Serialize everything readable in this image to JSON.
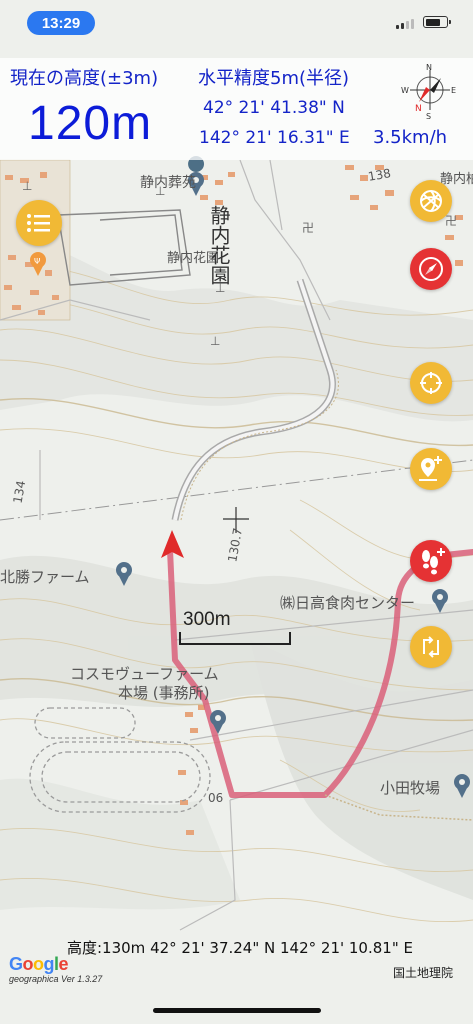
{
  "status_bar": {
    "time": "13:29"
  },
  "hud": {
    "altitude_label": "現在の高度(±3m)",
    "altitude_value": "120m",
    "accuracy_label": "水平精度5m(半径)",
    "latitude": "42° 21' 41.38\" N",
    "longitude": "142° 21' 16.31\" E",
    "speed": "3.5km/h"
  },
  "compass": {
    "north": "N",
    "south": "S",
    "east": "E",
    "west": "W"
  },
  "map_labels": {
    "cemetery": "静内葬苑",
    "park": "静内花園",
    "park_vertical": "静内花園",
    "farm_north": "北勝ファーム",
    "meat_center": "㈱日高食肉センター",
    "cosmo_farm_line1": "コスモヴューファーム",
    "cosmo_farm_line2": "本場 (事務所)",
    "oda_farm": "小田牧場",
    "elev_134": "134",
    "elev_130": "130.7",
    "elev_90": "90",
    "elev_138": "138",
    "city_edge": "静内柏"
  },
  "scale": {
    "label": "300m"
  },
  "cursor_readout": "高度:130m  42° 21' 37.24\" N 142° 21' 10.81\" E",
  "footer": {
    "google": [
      "G",
      "o",
      "o",
      "g",
      "l",
      "e"
    ],
    "version": "geographica Ver 1.3.27",
    "attribution": "国土地理院"
  },
  "buttons": {
    "menu": "list-icon",
    "layers": "spiral-icon",
    "compass": "compass-icon",
    "locate": "crosshair-icon",
    "add_point": "add-location-icon",
    "record": "footprints-add-icon",
    "route": "route-icon"
  },
  "colors": {
    "accent_blue": "#1424c8",
    "fab_orange": "#f1b935",
    "fab_red": "#e53234",
    "track": "#d9607a"
  }
}
